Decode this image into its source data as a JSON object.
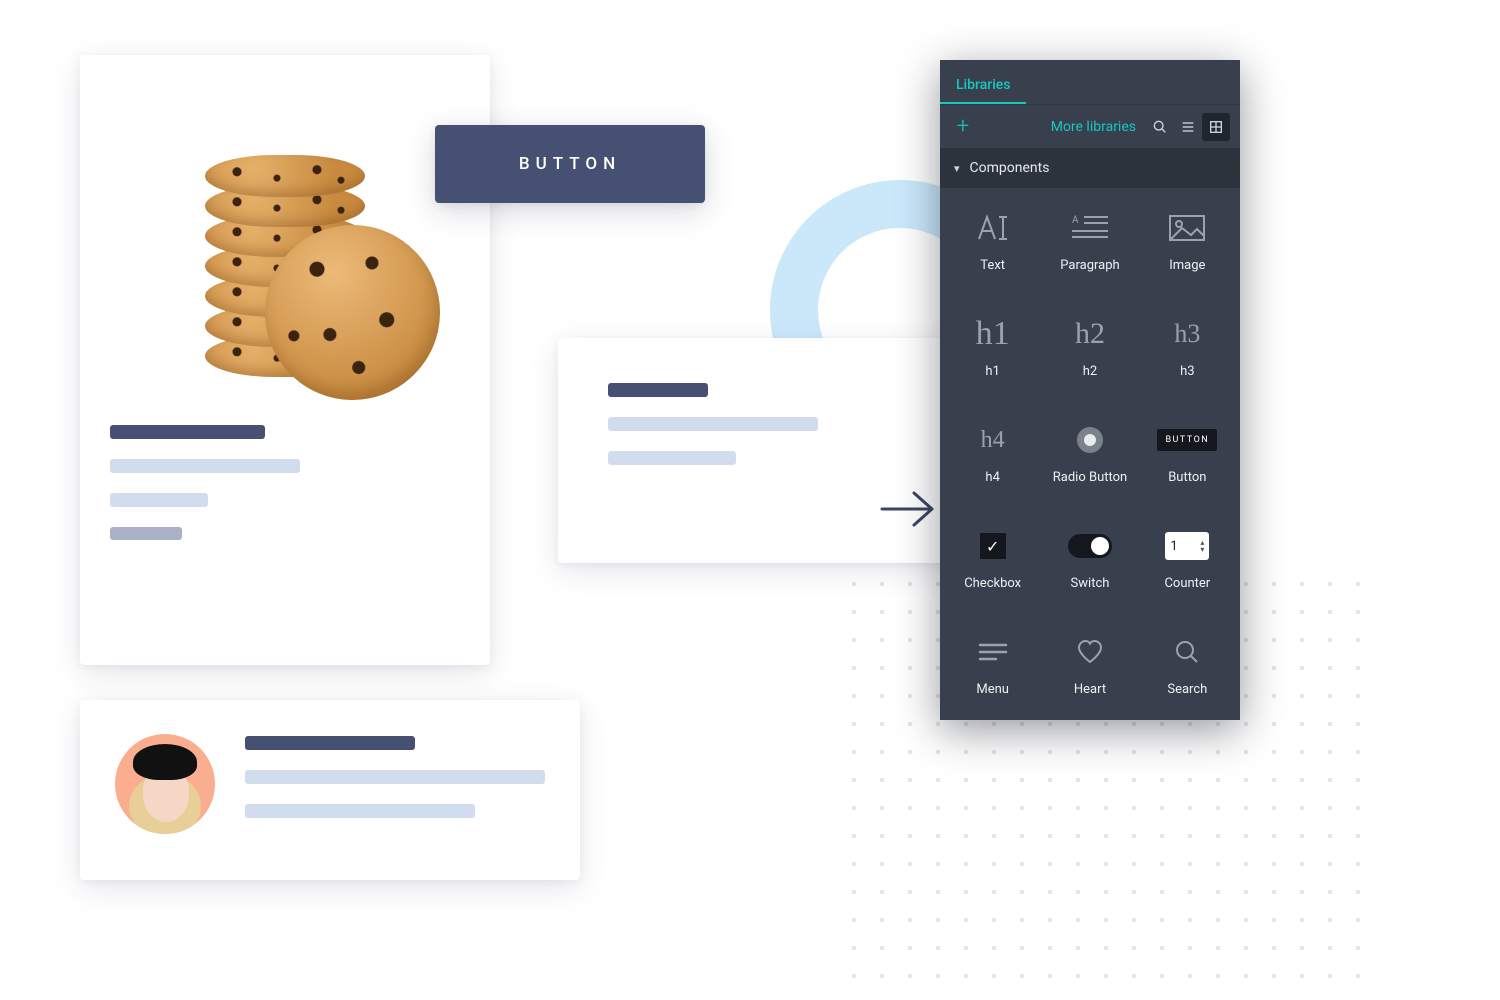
{
  "preview_button_label": "BUTTON",
  "panel": {
    "tab_label": "Libraries",
    "more_link": "More libraries",
    "section_label": "Components",
    "components": {
      "text": "Text",
      "paragraph": "Paragraph",
      "image": "Image",
      "h1": "h1",
      "h2": "h2",
      "h3": "h3",
      "h4": "h4",
      "radio": "Radio Button",
      "button": "Button",
      "checkbox": "Checkbox",
      "switch": "Switch",
      "counter": "Counter",
      "menu": "Menu",
      "heart": "Heart",
      "search": "Search"
    },
    "glyphs": {
      "h1": "h1",
      "h2": "h2",
      "h3": "h3",
      "h4": "h4",
      "button_chip": "BUTTON"
    },
    "counter_value": "1"
  }
}
